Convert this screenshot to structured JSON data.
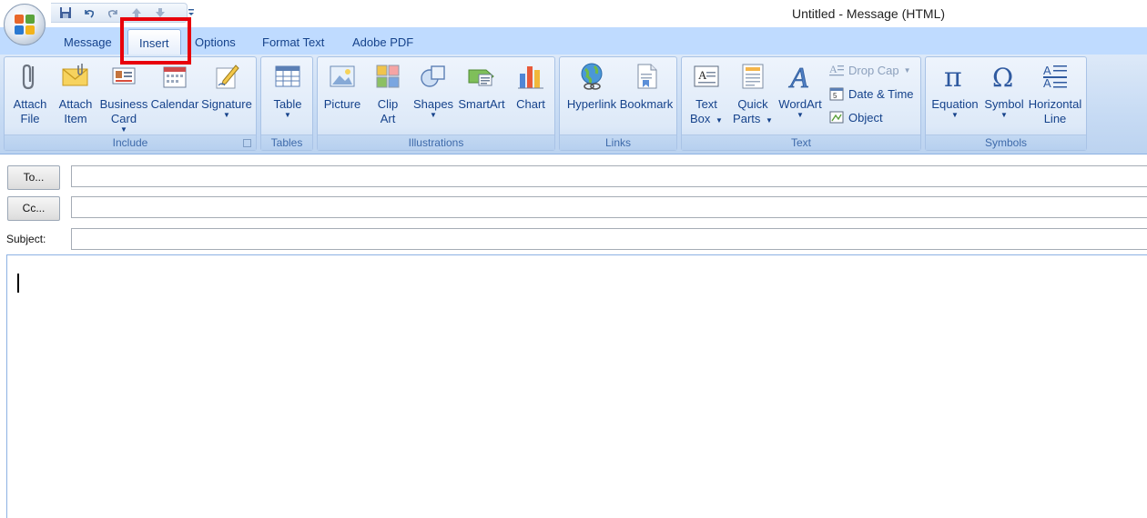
{
  "window": {
    "title": "Untitled - Message (HTML)"
  },
  "tabs": [
    {
      "label": "Message"
    },
    {
      "label": "Insert"
    },
    {
      "label": "Options"
    },
    {
      "label": "Format Text"
    },
    {
      "label": "Adobe PDF"
    }
  ],
  "active_tab": "Insert",
  "ribbon": {
    "include": {
      "label": "Include",
      "attach_file": [
        "Attach",
        "File"
      ],
      "attach_item": [
        "Attach",
        "Item"
      ],
      "business_card": [
        "Business",
        "Card"
      ],
      "calendar": "Calendar",
      "signature": "Signature"
    },
    "tables": {
      "label": "Tables",
      "table": "Table"
    },
    "illustrations": {
      "label": "Illustrations",
      "picture": "Picture",
      "clip_art": [
        "Clip",
        "Art"
      ],
      "shapes": "Shapes",
      "smartart": "SmartArt",
      "chart": "Chart"
    },
    "links": {
      "label": "Links",
      "hyperlink": "Hyperlink",
      "bookmark": "Bookmark"
    },
    "text": {
      "label": "Text",
      "text_box": [
        "Text",
        "Box"
      ],
      "quick_parts": [
        "Quick",
        "Parts"
      ],
      "wordart": "WordArt",
      "drop_cap": "Drop Cap",
      "date_time": "Date & Time",
      "object": "Object"
    },
    "symbols": {
      "label": "Symbols",
      "equation": "Equation",
      "symbol": "Symbol",
      "horizontal_line": [
        "Horizontal",
        "Line"
      ]
    }
  },
  "compose": {
    "to_button": "To...",
    "cc_button": "Cc...",
    "subject_label": "Subject:",
    "to_value": "",
    "cc_value": "",
    "subject_value": "",
    "body": ""
  },
  "colors": {
    "highlight": "#e8000b",
    "ribbon_bg": "#bfdbff",
    "text": "#15428b"
  }
}
